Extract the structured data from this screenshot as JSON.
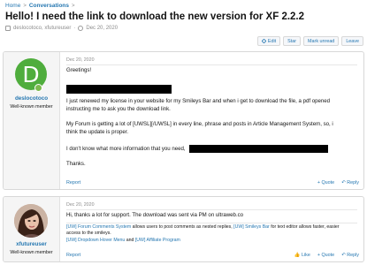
{
  "breadcrumb": {
    "home": "Home",
    "sep": ">",
    "section": "Conversations",
    "end": ">"
  },
  "thread": {
    "title": "Hello! I need the link to download the new version for XF 2.2.2",
    "participants": "deslocotoco, xfutureuser",
    "date": "Dec 20, 2020"
  },
  "actions": {
    "edit": "Edit",
    "star": "Star",
    "mark_unread": "Mark unread",
    "leave": "Leave"
  },
  "posts": [
    {
      "avatar_letter": "D",
      "username": "deslocotoco",
      "user_title": "Well-known member",
      "date": "Dec 20, 2020",
      "lines": {
        "greeting": "Greetings!",
        "p1a": "I just renewed my license in your website for my Smileys Bar and when i get to download the file, a pdf opened",
        "p1b": "instructing me to ask you the download link.",
        "p2a": "My Forum is getting a lot of [UWSL][/UWSL] in every line, phrase and posts in Article Management System, so, i",
        "p2b": "think the update is proper.",
        "p3": "I don't know what more information that you need,",
        "thanks": "Thanks."
      },
      "report": "Report",
      "quote": "+ Quote",
      "reply": "Reply"
    },
    {
      "username": "xfutureuser",
      "user_title": "Well-known member",
      "date": "Dec 20, 2020",
      "text": "Hi, thanks a lot for support. The download was sent via PM on ultraweb.co",
      "sig": {
        "l1_link": "[UW] Forum Comments System",
        "l1_mid": " allows users to post comments as nested replies, ",
        "l1_link2": "[UW] Smileys Bar",
        "l1_end": " for text editor allows faster, easier",
        "l2": "access to the smileys.",
        "l3_link": "[UW] Dropdown Hover Menu",
        "l3_mid": " and ",
        "l3_link2": "[UW] Affiliate Program"
      },
      "report": "Report",
      "like": "Like",
      "quote": "+ Quote",
      "reply": "Reply"
    }
  ],
  "colors": {
    "link": "#2577b1",
    "avatar": "#4fad3d",
    "online": "#7cba4e"
  }
}
